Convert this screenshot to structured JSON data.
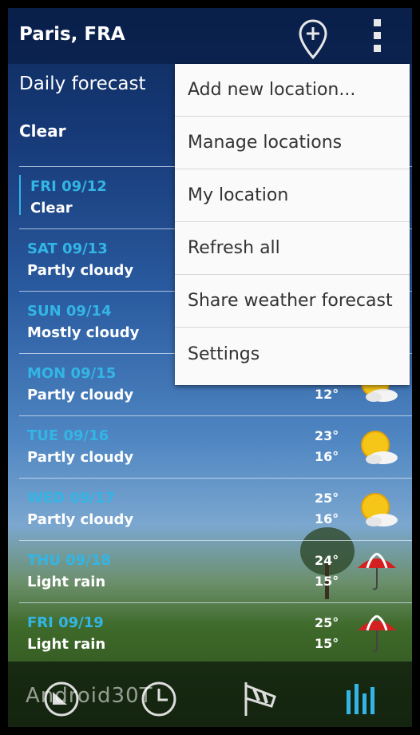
{
  "header": {
    "city": "Paris, FRA",
    "icons": [
      "add-location-pin-icon",
      "overflow-menu-icon"
    ]
  },
  "page": {
    "heading": "Daily forecast",
    "current_condition": "Clear"
  },
  "forecast": [
    {
      "date": "FRI 09/12",
      "condition": "Clear",
      "high": "",
      "low": "",
      "icon": "",
      "selected": true
    },
    {
      "date": "SAT 09/13",
      "condition": "Partly cloudy",
      "high": "",
      "low": "",
      "icon": ""
    },
    {
      "date": "SUN 09/14",
      "condition": "Mostly cloudy",
      "high": "",
      "low": "",
      "icon": ""
    },
    {
      "date": "MON 09/15",
      "condition": "Partly cloudy",
      "high": "",
      "low": "12°",
      "icon": "sun-cloud-icon"
    },
    {
      "date": "TUE 09/16",
      "condition": "Partly cloudy",
      "high": "23°",
      "low": "16°",
      "icon": "sun-cloud-icon"
    },
    {
      "date": "WED 09/17",
      "condition": "Partly cloudy",
      "high": "25°",
      "low": "16°",
      "icon": "sun-cloud-icon"
    },
    {
      "date": "THU 09/18",
      "condition": "Light rain",
      "high": "24°",
      "low": "15°",
      "icon": "umbrella-rain-icon"
    },
    {
      "date": "FRI 09/19",
      "condition": "Light rain",
      "high": "25°",
      "low": "15°",
      "icon": "umbrella-rain-icon"
    }
  ],
  "menu": {
    "items": [
      "Add new location...",
      "Manage locations",
      "My location",
      "Refresh all",
      "Share weather forecast",
      "Settings"
    ]
  },
  "bottom_tabs": [
    {
      "icon": "gauge-icon",
      "active": false
    },
    {
      "icon": "clock-icon",
      "active": false
    },
    {
      "icon": "windsock-icon",
      "active": false
    },
    {
      "icon": "bars-chart-icon",
      "active": true
    }
  ],
  "watermark": "Android30T",
  "colors": {
    "accent": "#33b5e5",
    "menu_bg": "#fafafa",
    "menu_text": "#333333"
  }
}
